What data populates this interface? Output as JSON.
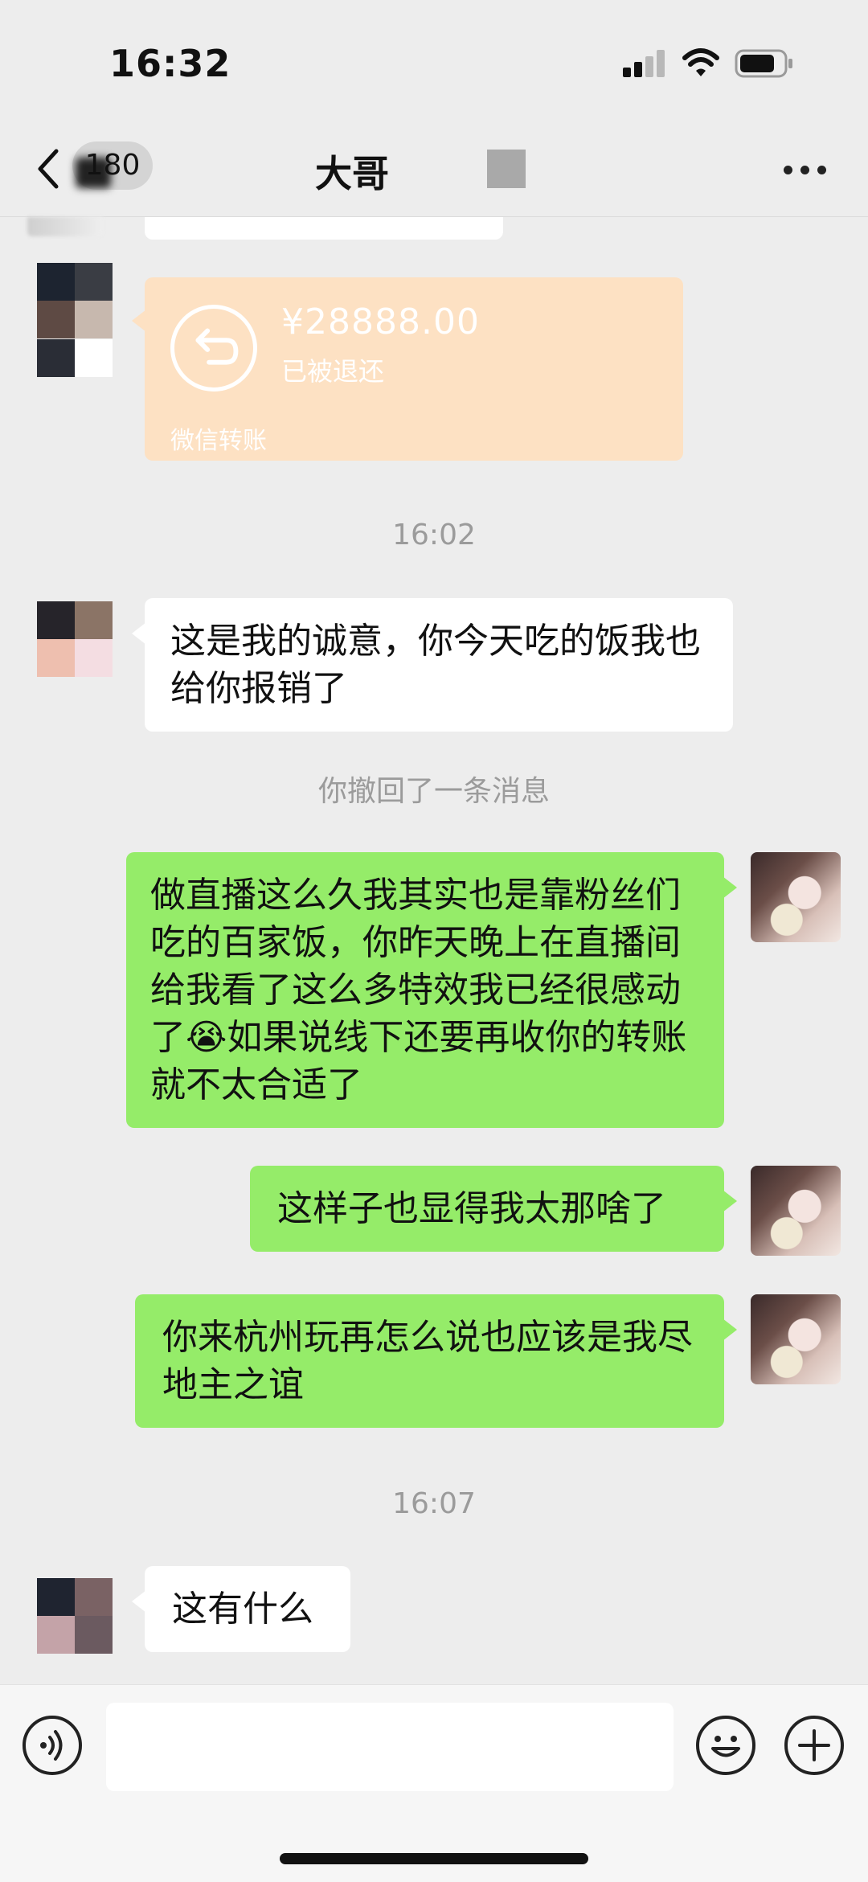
{
  "status_bar": {
    "time": "16:32"
  },
  "nav": {
    "unread_count": "180",
    "title": "大哥"
  },
  "transfer": {
    "amount": "¥28888.00",
    "status": "已被退还",
    "footer": "微信转账"
  },
  "timestamps": {
    "first": "16:02",
    "second": "16:07"
  },
  "system": {
    "recalled": "你撤回了一条消息"
  },
  "messages": [
    {
      "side": "in",
      "text": "这是我的诚意，你今天吃的饭我也给你报销了"
    },
    {
      "side": "out",
      "text": "做直播这么久我其实也是靠粉丝们吃的百家饭，你昨天晚上在直播间给我看了这么多特效我已经很感动了😭如果说线下还要再收你的转账就不太合适了"
    },
    {
      "side": "out",
      "text": "这样子也显得我太那啥了"
    },
    {
      "side": "out",
      "text": "你来杭州玩再怎么说也应该是我尽地主之谊"
    },
    {
      "side": "in",
      "text": "这有什么"
    }
  ],
  "input": {
    "value": ""
  },
  "icons": {
    "back": "chevron-left-icon",
    "more": "more-icon",
    "voice": "voice-icon",
    "emoji": "emoji-icon",
    "plus": "plus-icon",
    "return": "return-icon"
  },
  "colors": {
    "out_bubble": "#95ec69",
    "in_bubble": "#ffffff",
    "transfer_card": "#fde1c3",
    "background": "#ededed"
  }
}
